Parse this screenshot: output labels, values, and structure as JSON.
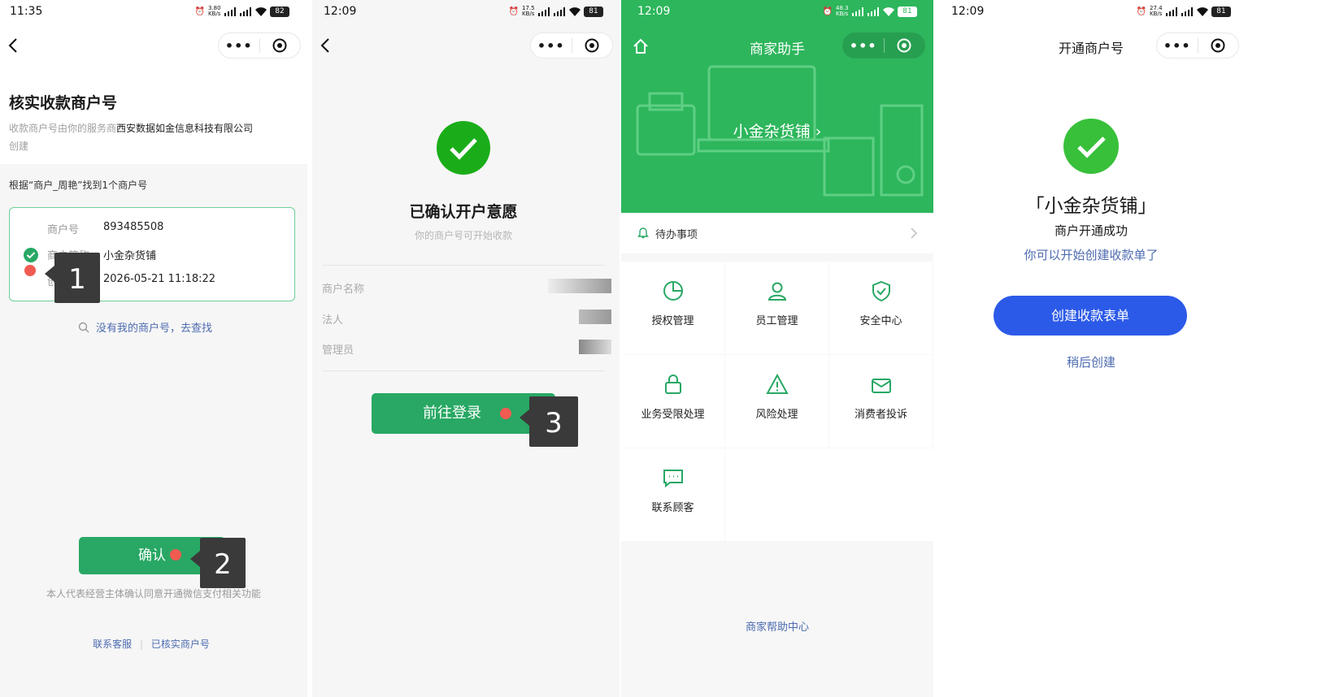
{
  "colors": {
    "accent": "#28a864",
    "link": "#4d6bb0",
    "blue_button": "#2c5ae8",
    "callout": "#3a3a3a",
    "marker": "#f15b52"
  },
  "panel1": {
    "status": {
      "time": "11:35",
      "speed": "3.80 KB/s",
      "battery": "82"
    },
    "title": "核实收款商户号",
    "subtitle_prefix": "收款商户号由你的服务商",
    "subtitle_company": "西安数据如金信息科技有限公司",
    "subtitle_suffix": "创建",
    "found_text": "根据“商户_周艳”找到1个商户号",
    "merchant": {
      "rows": [
        {
          "label": "商户号",
          "value": "893485508"
        },
        {
          "label": "商户简称",
          "value": "小金杂货铺"
        },
        {
          "label": "创建时间",
          "value": "2026-05-21 11:18:22"
        }
      ]
    },
    "search_link": "没有我的商户号，去查找",
    "confirm_label": "确认",
    "agreement": "本人代表经营主体确认同意开通微信支付相关功能",
    "footer_links": [
      "联系客服",
      "已核实商户号"
    ],
    "callout_1": "1",
    "callout_2": "2"
  },
  "panel2": {
    "status": {
      "time": "12:09",
      "speed": "17.5 KB/s",
      "battery": "81"
    },
    "title": "已确认开户意愿",
    "subtitle": "你的商户号可开始收款",
    "rows": [
      {
        "label": "商户名称"
      },
      {
        "label": "法人"
      },
      {
        "label": "管理员"
      }
    ],
    "login_label": "前往登录",
    "callout_3": "3"
  },
  "panel3": {
    "status": {
      "time": "12:09",
      "speed": "48.3 KB/s",
      "battery": "81"
    },
    "nav_title": "商家助手",
    "shop_name": "小金杂货铺 ›",
    "todo_label": "待办事项",
    "grid": [
      {
        "label": "授权管理",
        "icon": "pie-chart-icon"
      },
      {
        "label": "员工管理",
        "icon": "user-icon"
      },
      {
        "label": "安全中心",
        "icon": "shield-check-icon"
      },
      {
        "label": "业务受限处理",
        "icon": "lock-icon"
      },
      {
        "label": "风险处理",
        "icon": "warning-icon"
      },
      {
        "label": "消费者投诉",
        "icon": "envelope-icon"
      },
      {
        "label": "联系顾客",
        "icon": "chat-icon"
      }
    ],
    "help_link": "商家帮助中心"
  },
  "panel4": {
    "status": {
      "time": "12:09",
      "speed": "27.4 KB/s",
      "battery": "81"
    },
    "nav_title": "开通商户号",
    "shop_name": "「小金杂货铺」",
    "success_text": "商户开通成功",
    "hint": "你可以开始创建收款单了",
    "create_label": "创建收款表单",
    "later_label": "稍后创建"
  }
}
